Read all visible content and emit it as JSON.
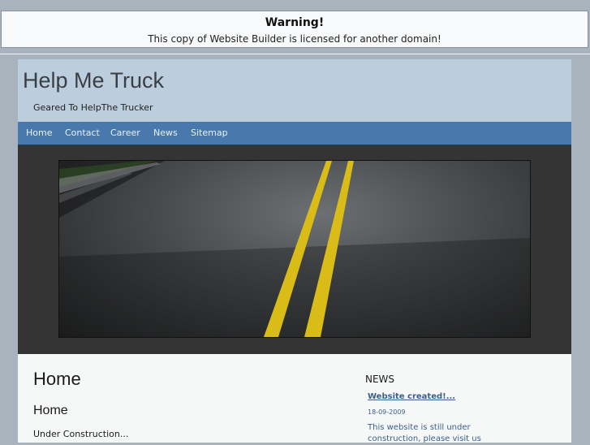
{
  "warning": {
    "title": "Warning!",
    "message": "This copy of Website Builder is licensed for another domain!"
  },
  "header": {
    "site_title": "Help Me Truck",
    "tagline": "Geared To HelpThe Trucker"
  },
  "nav": {
    "items": [
      {
        "label": "Home"
      },
      {
        "label": "Contact"
      },
      {
        "label": "Career"
      },
      {
        "label": "News"
      },
      {
        "label": "Sitemap"
      }
    ]
  },
  "main": {
    "heading": "Home",
    "subheading": "Home",
    "text": "Under Construction..."
  },
  "news": {
    "heading": "NEWS",
    "item_title": "Website created!...",
    "item_date": "18-09-2009",
    "item_body": "This website is still under construction, please visit us"
  },
  "colors": {
    "background": "#a9b3bd",
    "header": "#bccddd",
    "nav": "#4979ac",
    "hero": "#343434",
    "link": "#3c5f8c"
  }
}
